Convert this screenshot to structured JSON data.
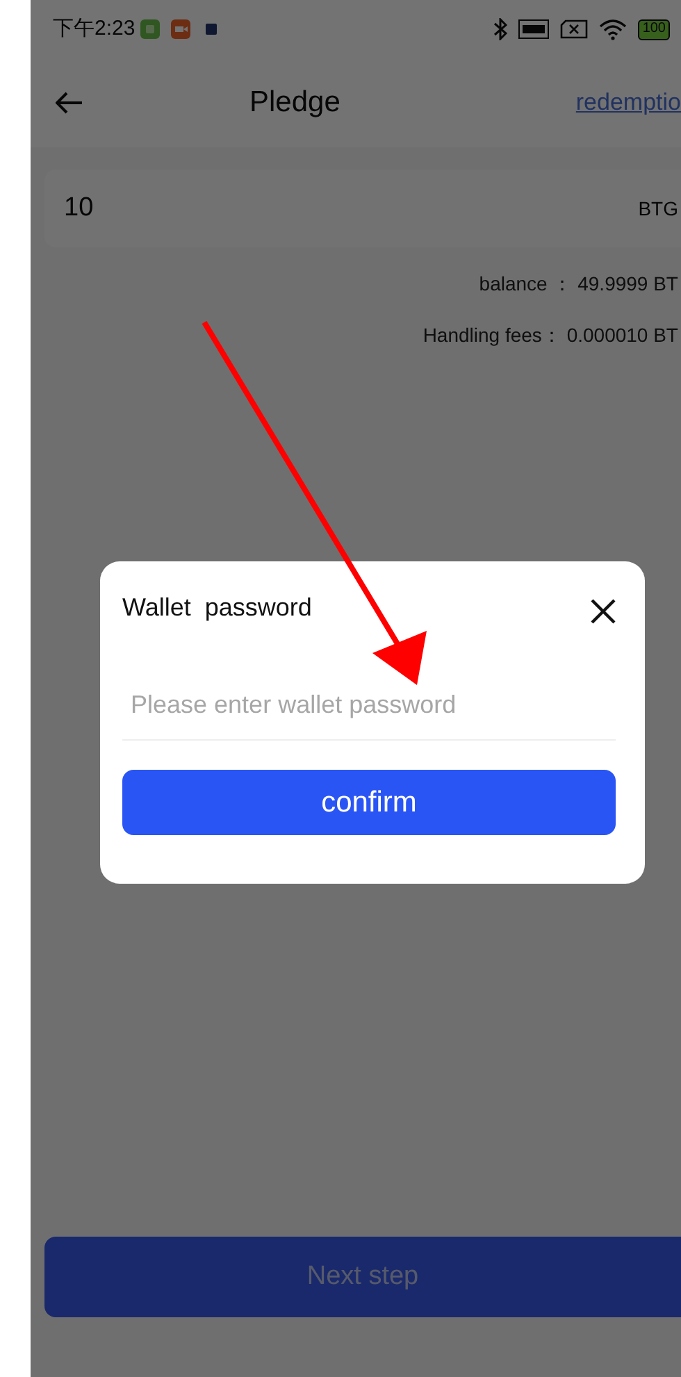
{
  "status_bar": {
    "time": "下午2:23",
    "battery": "100"
  },
  "header": {
    "title": "Pledge",
    "action": "redemptio"
  },
  "amount_field": {
    "value": "10",
    "unit": "BTG"
  },
  "balance": "balance ： 49.9999 BT",
  "handling_fees": "Handling fees： 0.000010 BT",
  "dialog": {
    "title": "Wallet  password",
    "placeholder": "Please enter wallet password",
    "confirm": "confirm"
  },
  "next_button": "Next step"
}
